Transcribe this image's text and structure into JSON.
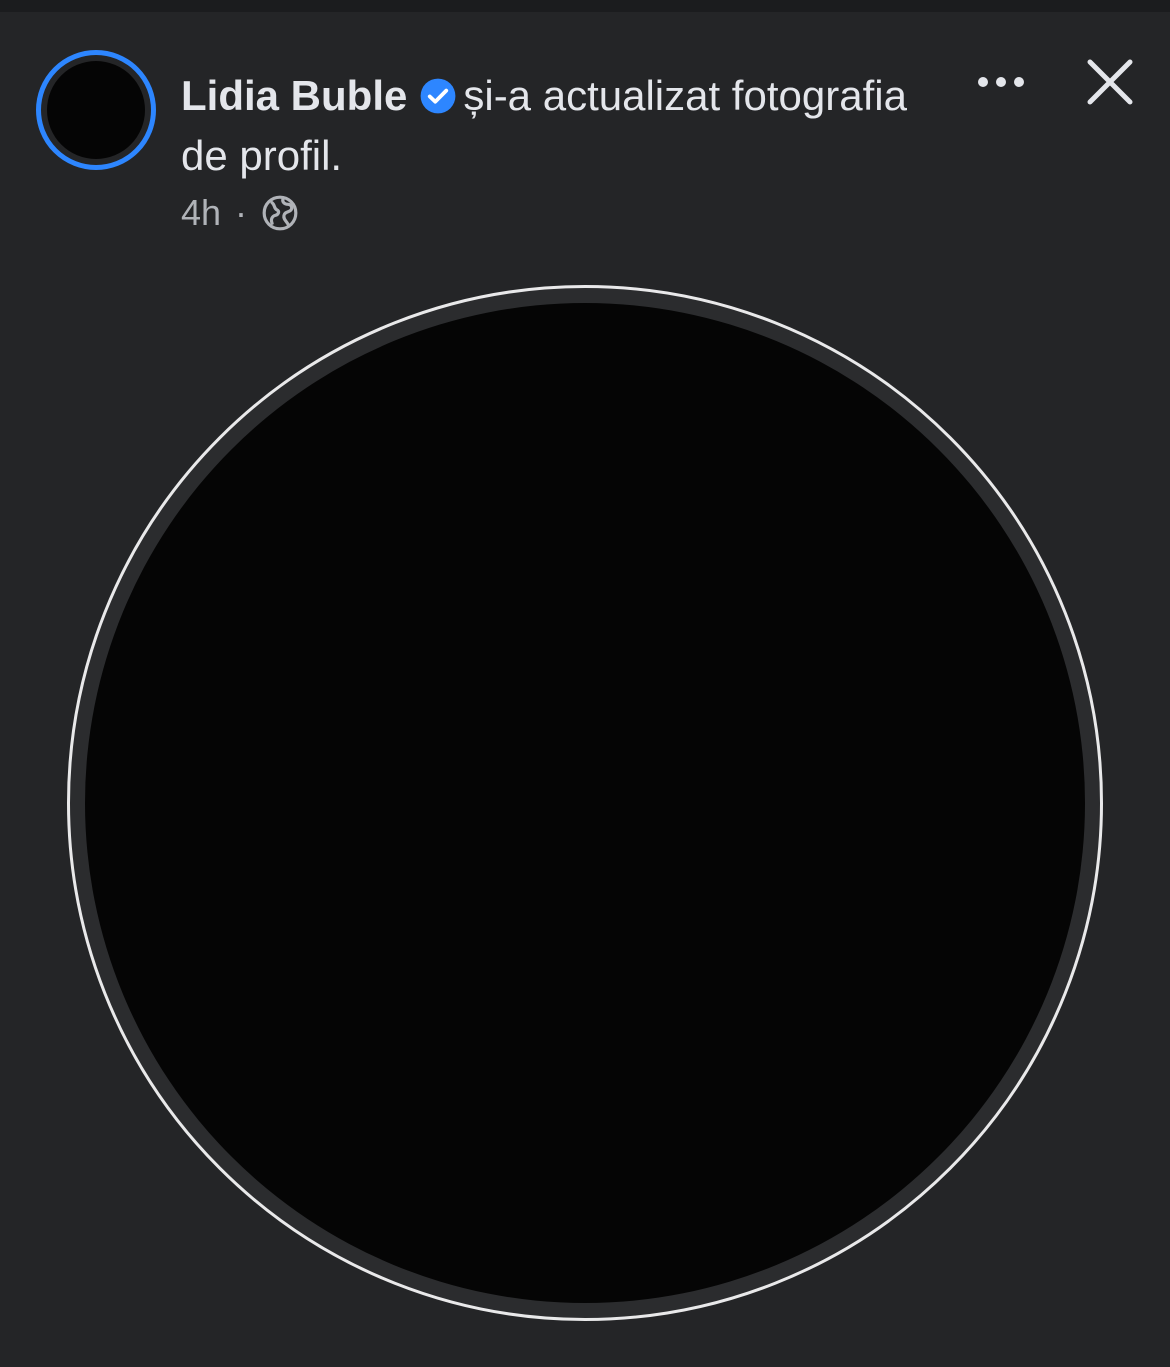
{
  "post": {
    "author_name": "Lidia Buble",
    "action_text": "și-a actualizat fotografia de profil.",
    "time_ago": "4h",
    "separator": "·",
    "audience_icon": "globe-icon",
    "verified_icon": "verified-badge-icon"
  },
  "header_actions": {
    "more_icon": "more-options-icon",
    "close_icon": "close-icon"
  },
  "colors": {
    "background": "#242527",
    "avatar_ring": "#2d86ff",
    "verified_badge": "#2d86ff",
    "primary_text": "#e4e6eb",
    "secondary_text": "#b0b3b8",
    "photo_border": "#e9e9ea"
  }
}
